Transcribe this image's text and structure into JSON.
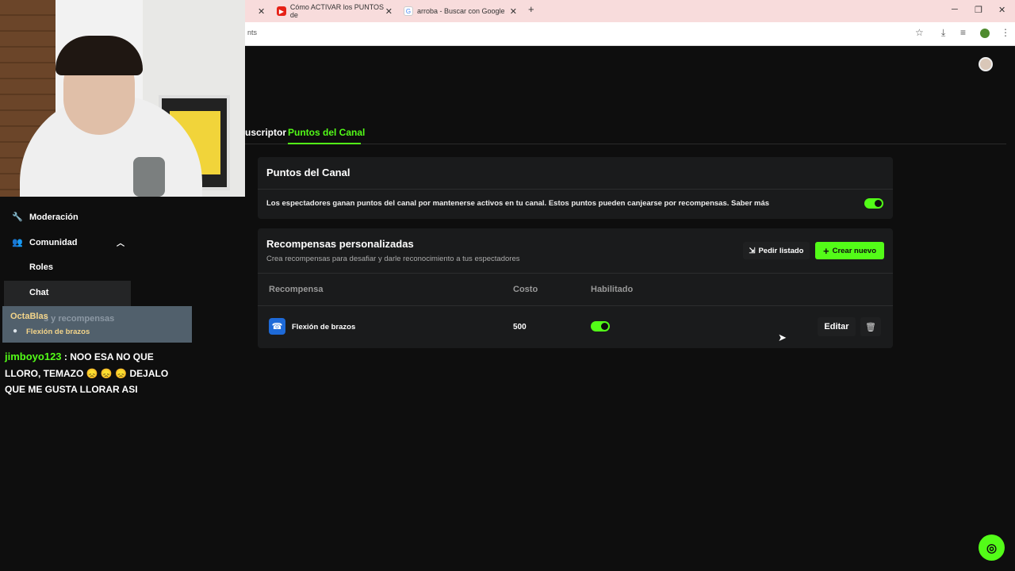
{
  "browser": {
    "tabs": [
      {
        "title": "Cómo ACTIVAR los PUNTOS de"
      },
      {
        "title": "arroba - Buscar con Google"
      }
    ],
    "url": "nts"
  },
  "page": {
    "tabs": {
      "subscriber": "uscriptor",
      "points": "Puntos del Canal"
    },
    "channel_points": {
      "title": "Puntos del Canal",
      "description": "Los espectadores ganan puntos del canal por mantenerse activos en tu canal. Estos puntos pueden canjearse por recompensas. Saber más",
      "enabled": true
    },
    "custom_rewards": {
      "title": "Recompensas personalizadas",
      "subtitle": "Crea recompensas para desafiar y darle reconocimiento a tus espectadores",
      "request_list_label": "Pedir listado",
      "create_label": "Crear nuevo",
      "columns": [
        "Recompensa",
        "Costo",
        "Habilitado"
      ],
      "rows": [
        {
          "name": "Flexión de brazos",
          "cost": "500",
          "enabled": true,
          "edit_label": "Editar"
        }
      ]
    }
  },
  "sidebar": {
    "items": [
      {
        "label": "Moderación",
        "icon": "wrench-icon"
      },
      {
        "label": "Comunidad",
        "icon": "users-icon"
      },
      {
        "label": "Roles"
      },
      {
        "label": "Chat"
      }
    ]
  },
  "chat_overlay": {
    "notice": {
      "user": "OctaBlas",
      "faded_text": "s y recompensas",
      "reward": "Flexión de brazos"
    },
    "message": {
      "user": "jimboyo123",
      "text": " : NOO ESA NO QUE LLORO, TEMAZO 😞 😞 😞 DEJALO QUE ME GUSTA LLORAR ASI"
    }
  },
  "colors": {
    "accent": "#53fc18",
    "background": "#0e0e0e",
    "card": "#1a1b1c"
  }
}
